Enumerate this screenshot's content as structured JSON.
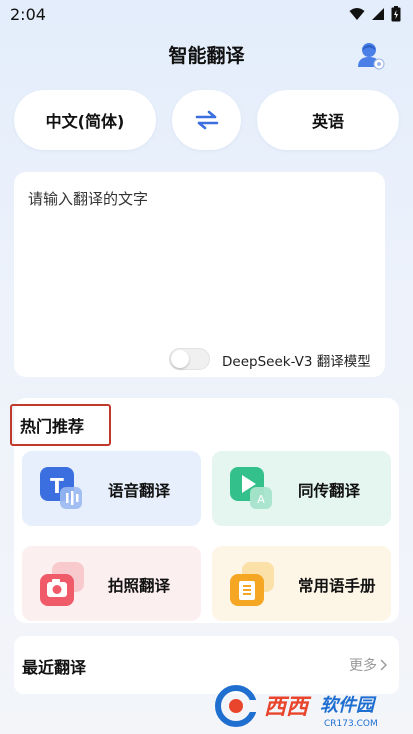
{
  "status_bar": {
    "time": "2:04"
  },
  "header": {
    "title": "智能翻译"
  },
  "languages": {
    "source": "中文(简体)",
    "target": "英语"
  },
  "input": {
    "placeholder": "请输入翻译的文字",
    "value": ""
  },
  "model": {
    "label": "DeepSeek-V3 翻译模型",
    "enabled": false
  },
  "hot": {
    "title": "热门推荐",
    "items": [
      {
        "label": "语音翻译",
        "icon": "voice-translate-icon"
      },
      {
        "label": "同传翻译",
        "icon": "simultaneous-translate-icon"
      },
      {
        "label": "拍照翻译",
        "icon": "camera-translate-icon"
      },
      {
        "label": "常用语手册",
        "icon": "phrasebook-icon"
      }
    ]
  },
  "recent": {
    "title": "最近翻译",
    "more": "更多"
  },
  "watermark": {
    "brand": "西西",
    "sub": "软件园",
    "url": "CR173.COM"
  },
  "colors": {
    "accent": "#3b6fe0",
    "hot_border": "#c0392b"
  }
}
